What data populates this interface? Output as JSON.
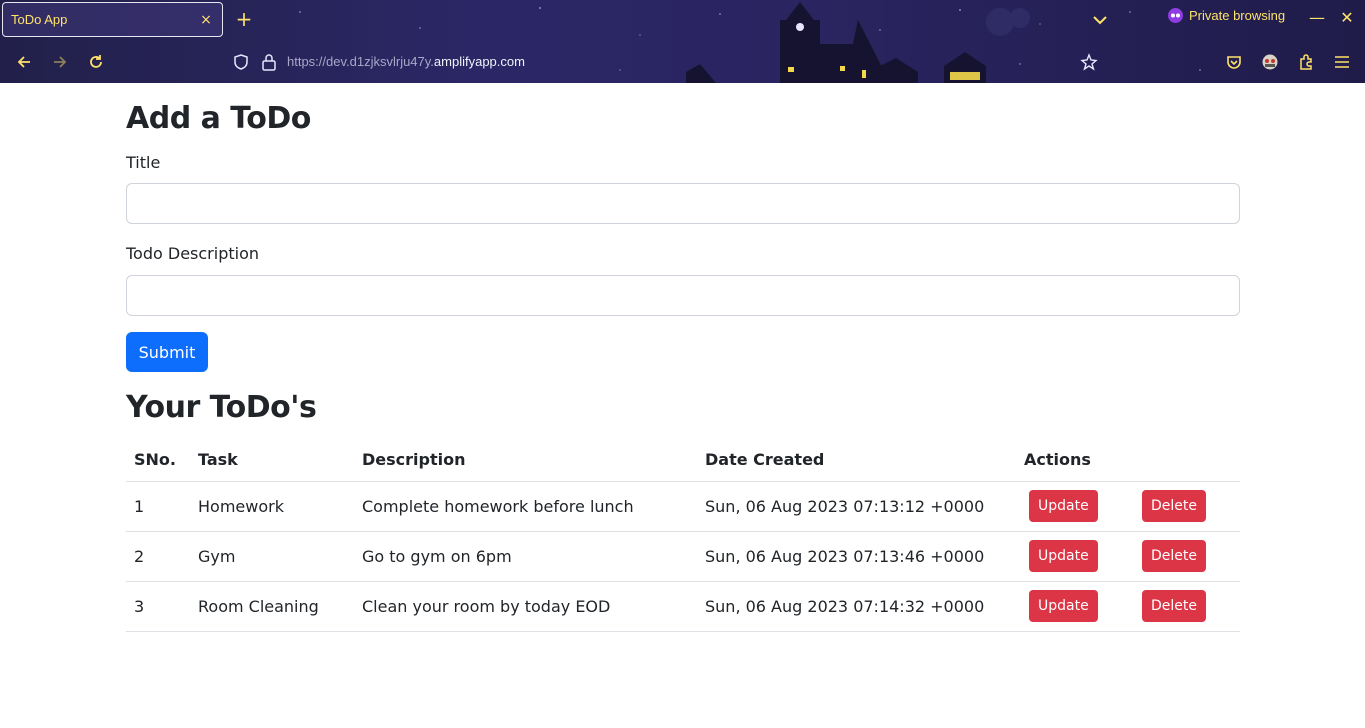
{
  "browser": {
    "tab_title": "ToDo App",
    "tab_close": "×",
    "new_tab": "+",
    "private_label": "Private browsing",
    "minimize": "—",
    "close": "✕",
    "url_scheme": "https://dev.d1zjksvlrju47y.",
    "url_host": "amplifyapp.com",
    "icons": [
      "back-arrow-icon",
      "forward-arrow-icon",
      "reload-icon",
      "shield-icon",
      "lock-icon",
      "bookmark-star-icon",
      "pocket-icon",
      "extension-avatar-icon",
      "extensions-puzzle-icon",
      "menu-icon",
      "tab-list-chevron-icon",
      "private-mask-icon"
    ],
    "accent_color": "#ffe26a"
  },
  "form": {
    "heading": "Add a ToDo",
    "title_label": "Title",
    "title_value": "",
    "description_label": "Todo Description",
    "description_value": "",
    "submit_label": "Submit",
    "submit_color": "#0d6efd"
  },
  "list": {
    "heading": "Your ToDo's",
    "columns": [
      "SNo.",
      "Task",
      "Description",
      "Date Created",
      "Actions"
    ],
    "rows": [
      {
        "sno": "1",
        "task": "Homework",
        "description": "Complete homework before lunch",
        "date": "Sun, 06 Aug 2023 07:13:12 +0000",
        "update": "Update",
        "delete": "Delete"
      },
      {
        "sno": "2",
        "task": "Gym",
        "description": "Go to gym on 6pm",
        "date": "Sun, 06 Aug 2023 07:13:46 +0000",
        "update": "Update",
        "delete": "Delete"
      },
      {
        "sno": "3",
        "task": "Room Cleaning",
        "description": "Clean your room by today EOD",
        "date": "Sun, 06 Aug 2023 07:14:32 +0000",
        "update": "Update",
        "delete": "Delete"
      }
    ],
    "action_color": "#dc3545"
  }
}
